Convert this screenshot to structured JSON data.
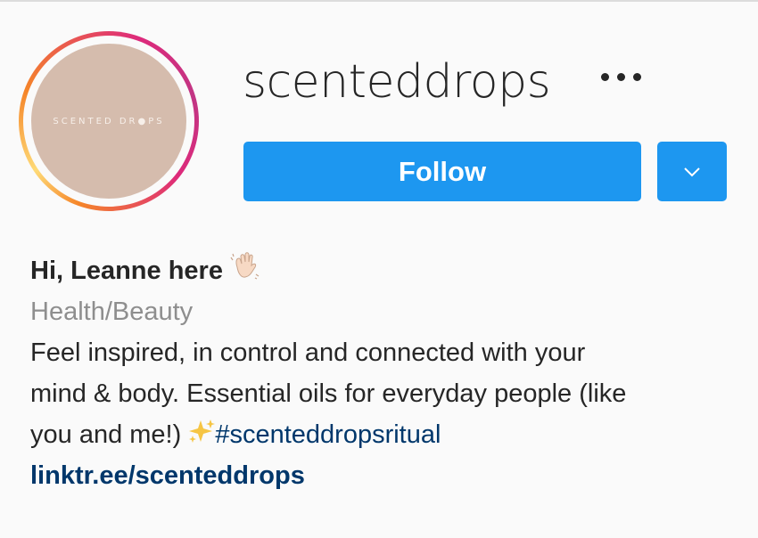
{
  "profile": {
    "avatar_text": "SCENTED DR●PS",
    "username": "scenteddrops",
    "follow_label": "Follow",
    "name": "Hi, Leanne here",
    "name_emoji": "waving-hand-icon",
    "category": "Health/Beauty",
    "bio_lines": [
      "Feel inspired, in control and connected with your",
      "mind & body. Essential oils for everyday people (like",
      "you and me!) "
    ],
    "bio_emoji": "sparkles-icon",
    "hashtag": "#scenteddropsritual",
    "link": "linktr.ee/scenteddrops"
  },
  "colors": {
    "follow_blue": "#1d97f0",
    "link_blue": "#00376b",
    "category_gray": "#8e8e8e",
    "avatar_bg": "#d5bcad"
  }
}
